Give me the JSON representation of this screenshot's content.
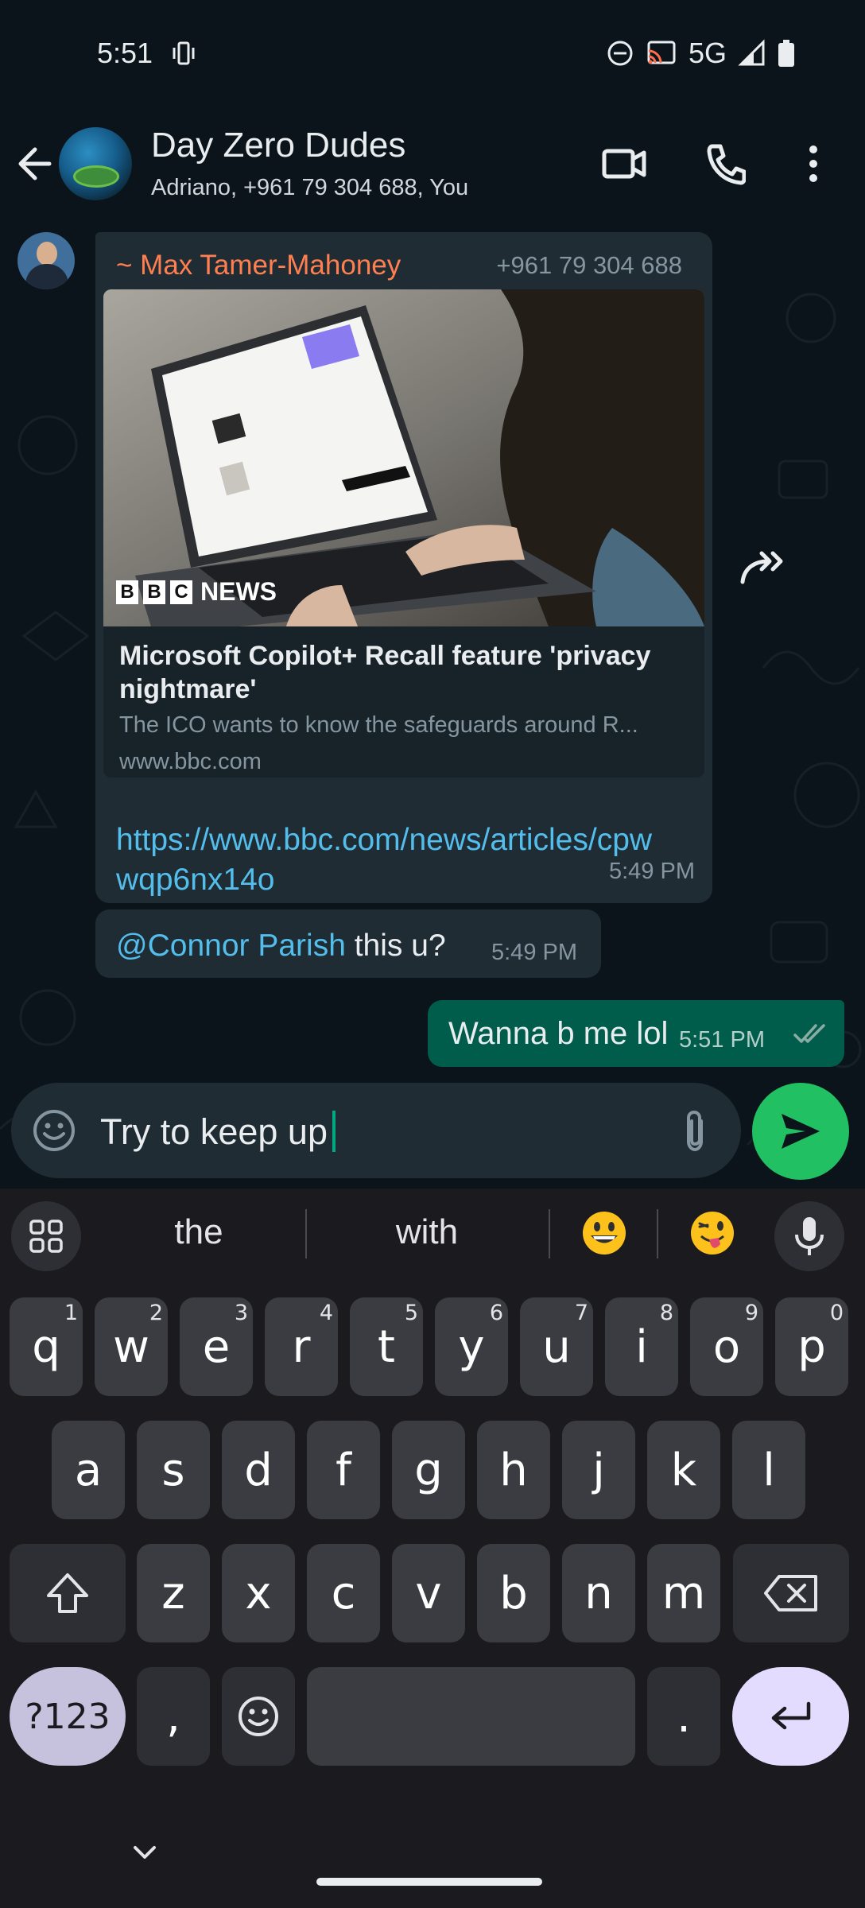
{
  "status_bar": {
    "time": "5:51",
    "network": "5G",
    "icons": [
      "vibrate-icon",
      "dnd-icon",
      "cast-icon",
      "signal-icon",
      "battery-icon"
    ]
  },
  "header": {
    "title": "Day Zero Dudes",
    "subtitle": "Adriano, +961 79 304 688, You",
    "icons": [
      "back-arrow-icon",
      "video-call-icon",
      "phone-icon",
      "more-vert-icon"
    ]
  },
  "messages": [
    {
      "direction": "incoming",
      "sender": "~ Max Tamer-Mahoney",
      "sender_phone": "+961 79 304 688",
      "link_preview": {
        "source_logo": [
          "B",
          "B",
          "C"
        ],
        "source_name": "NEWS",
        "title": "Microsoft Copilot+ Recall feature 'privacy nightmare'",
        "description": "The ICO wants to know the safeguards around R...",
        "domain": "www.bbc.com"
      },
      "text": "https://www.bbc.com/news/articles/cpwwqp6nx14o",
      "time": "5:49 PM"
    },
    {
      "direction": "incoming",
      "mention": "@Connor Parish",
      "text": " this u?",
      "time": "5:49 PM"
    },
    {
      "direction": "outgoing",
      "text": "Wanna b me lol",
      "time": "5:51 PM",
      "status": "read"
    }
  ],
  "composer": {
    "value": "Try to keep up"
  },
  "keyboard": {
    "suggestions": [
      "the",
      "with",
      "😀",
      "😜"
    ],
    "row1": [
      {
        "k": "q",
        "n": "1"
      },
      {
        "k": "w",
        "n": "2"
      },
      {
        "k": "e",
        "n": "3"
      },
      {
        "k": "r",
        "n": "4"
      },
      {
        "k": "t",
        "n": "5"
      },
      {
        "k": "y",
        "n": "6"
      },
      {
        "k": "u",
        "n": "7"
      },
      {
        "k": "i",
        "n": "8"
      },
      {
        "k": "o",
        "n": "9"
      },
      {
        "k": "p",
        "n": "0"
      }
    ],
    "row2": [
      "a",
      "s",
      "d",
      "f",
      "g",
      "h",
      "j",
      "k",
      "l"
    ],
    "row3": [
      "z",
      "x",
      "c",
      "v",
      "b",
      "n",
      "m"
    ],
    "sym_label": "?123",
    "comma": ",",
    "period": "."
  },
  "colors": {
    "background": "#0b141a",
    "incoming_bubble": "#1f2c34",
    "outgoing_bubble": "#005c4b",
    "sender_name": "#ff7f50",
    "link": "#53bdeb",
    "send_button": "#21c063"
  }
}
